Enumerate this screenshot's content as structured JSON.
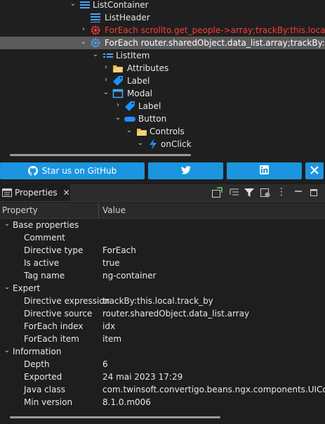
{
  "tree": {
    "nodes": [
      {
        "label": "ListContainer",
        "icon": "list-container-icon",
        "expanded": true,
        "selected": false,
        "error": false
      },
      {
        "label": "ListHeader",
        "icon": "list-header-icon",
        "expanded": null,
        "selected": false,
        "error": false
      },
      {
        "label": "ForEach scrollto.get_people->array;trackBy:this.local.track",
        "icon": "gear-error-icon",
        "expanded": false,
        "selected": false,
        "error": true
      },
      {
        "label": "ForEach router.sharedObject.data_list.array;trackBy:this.l",
        "icon": "gear-icon",
        "expanded": true,
        "selected": true,
        "error": false
      },
      {
        "label": "ListItem",
        "icon": "list-item-icon",
        "expanded": true,
        "selected": false,
        "error": false
      },
      {
        "label": "Attributes",
        "icon": "folder-icon",
        "expanded": false,
        "selected": false,
        "error": false
      },
      {
        "label": "Label",
        "icon": "label-icon",
        "expanded": false,
        "selected": false,
        "error": false
      },
      {
        "label": "Modal",
        "icon": "modal-icon",
        "expanded": true,
        "selected": false,
        "error": false
      },
      {
        "label": "Label",
        "icon": "label-icon",
        "expanded": false,
        "selected": false,
        "error": false
      },
      {
        "label": "Button",
        "icon": "button-icon",
        "expanded": true,
        "selected": false,
        "error": false
      },
      {
        "label": "Controls",
        "icon": "folder-icon",
        "expanded": true,
        "selected": false,
        "error": false
      },
      {
        "label": "onClick",
        "icon": "lightning-icon",
        "expanded": true,
        "selected": false,
        "error": false
      }
    ]
  },
  "social": {
    "github_label": "Star us on GitHub",
    "github_icon": "github-icon",
    "twitter_icon": "twitter-icon",
    "linkedin_icon": "linkedin-icon",
    "close_icon": "close-icon",
    "color": "#1b95e0"
  },
  "panel": {
    "tab_label": "Properties",
    "tab_icon": "properties-icon",
    "toolbar_icons": [
      "new-icon",
      "categories-icon",
      "filter-icon",
      "restore-icon",
      "view-menu-icon",
      "minimize-icon",
      "maximize-icon"
    ]
  },
  "columns": {
    "property": "Property",
    "value": "Value"
  },
  "properties": {
    "groups": [
      {
        "name": "Base properties",
        "items": [
          {
            "key": "Comment",
            "value": ""
          },
          {
            "key": "Directive type",
            "value": "ForEach"
          },
          {
            "key": "Is active",
            "value": "true"
          },
          {
            "key": "Tag name",
            "value": "ng-container"
          }
        ]
      },
      {
        "name": "Expert",
        "items": [
          {
            "key": "Directive expression",
            "value": "trackBy:this.local.track_by"
          },
          {
            "key": "Directive source",
            "value": "router.sharedObject.data_list.array"
          },
          {
            "key": "ForEach index",
            "value": "idx"
          },
          {
            "key": "ForEach item",
            "value": "item"
          }
        ]
      },
      {
        "name": "Information",
        "items": [
          {
            "key": "Depth",
            "value": "6"
          },
          {
            "key": "Exported",
            "value": "24 mai 2023 17:29"
          },
          {
            "key": "Java class",
            "value": "com.twinsoft.convertigo.beans.ngx.components.UIContr"
          },
          {
            "key": "Min version",
            "value": "8.1.0.m006"
          }
        ]
      }
    ]
  }
}
